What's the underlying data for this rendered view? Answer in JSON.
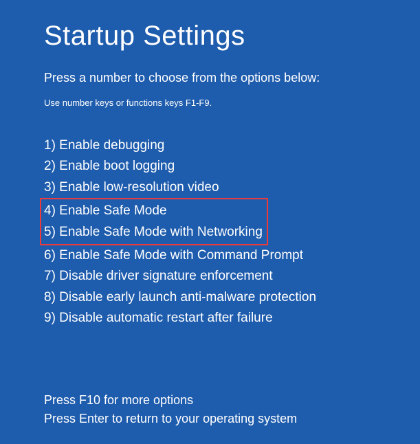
{
  "title": "Startup Settings",
  "subtitle": "Press a number to choose from the options below:",
  "instruction": "Use number keys or functions keys F1-F9.",
  "options": [
    "1) Enable debugging",
    "2) Enable boot logging",
    "3) Enable low-resolution video",
    "4) Enable Safe Mode",
    "5) Enable Safe Mode with Networking",
    "6) Enable Safe Mode with Command Prompt",
    "7) Disable driver signature enforcement",
    "8) Disable early launch anti-malware protection",
    "9) Disable automatic restart after failure"
  ],
  "footer": {
    "more": "Press F10 for more options",
    "return": "Press Enter to return to your operating system"
  }
}
